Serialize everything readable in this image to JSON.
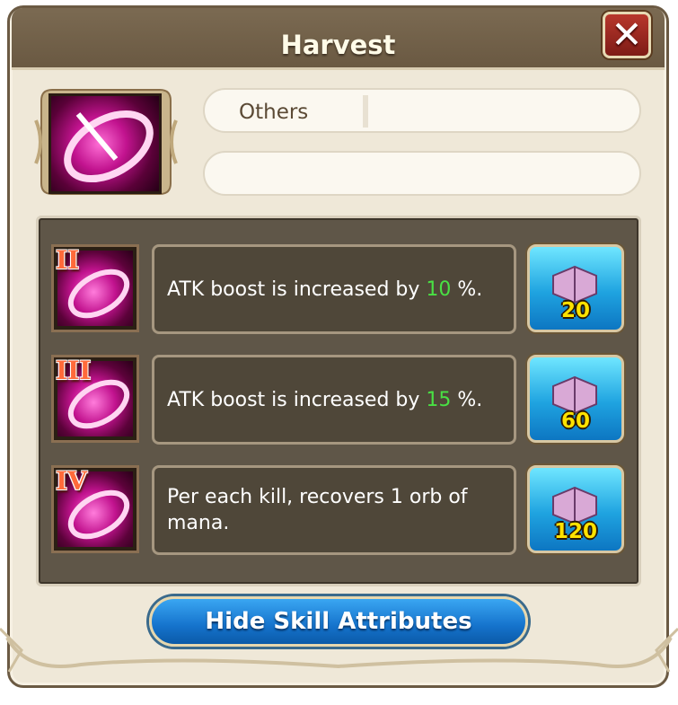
{
  "dialog": {
    "title": "Harvest"
  },
  "header_icons": {
    "close": "close-x-icon"
  },
  "info": {
    "category_label": "Others",
    "second_pill_text": ""
  },
  "upgrades": [
    {
      "rank": "II",
      "prefix": "ATK boost is increased by ",
      "value": "10",
      "suffix": " %.",
      "cost": "20"
    },
    {
      "rank": "III",
      "prefix": "ATK boost is increased by ",
      "value": "15",
      "suffix": " %.",
      "cost": "60"
    },
    {
      "rank": "IV",
      "prefix": "Per each kill, recovers 1 orb of mana.",
      "value": "",
      "suffix": "",
      "cost": "120"
    }
  ],
  "footer": {
    "hide_button_label": "Hide Skill Attributes"
  },
  "colors": {
    "header": "#6a5942",
    "panel": "#5f5648",
    "highlight_value": "#49e044",
    "cost": "#ffe200",
    "button_blue": "#1573cc"
  }
}
